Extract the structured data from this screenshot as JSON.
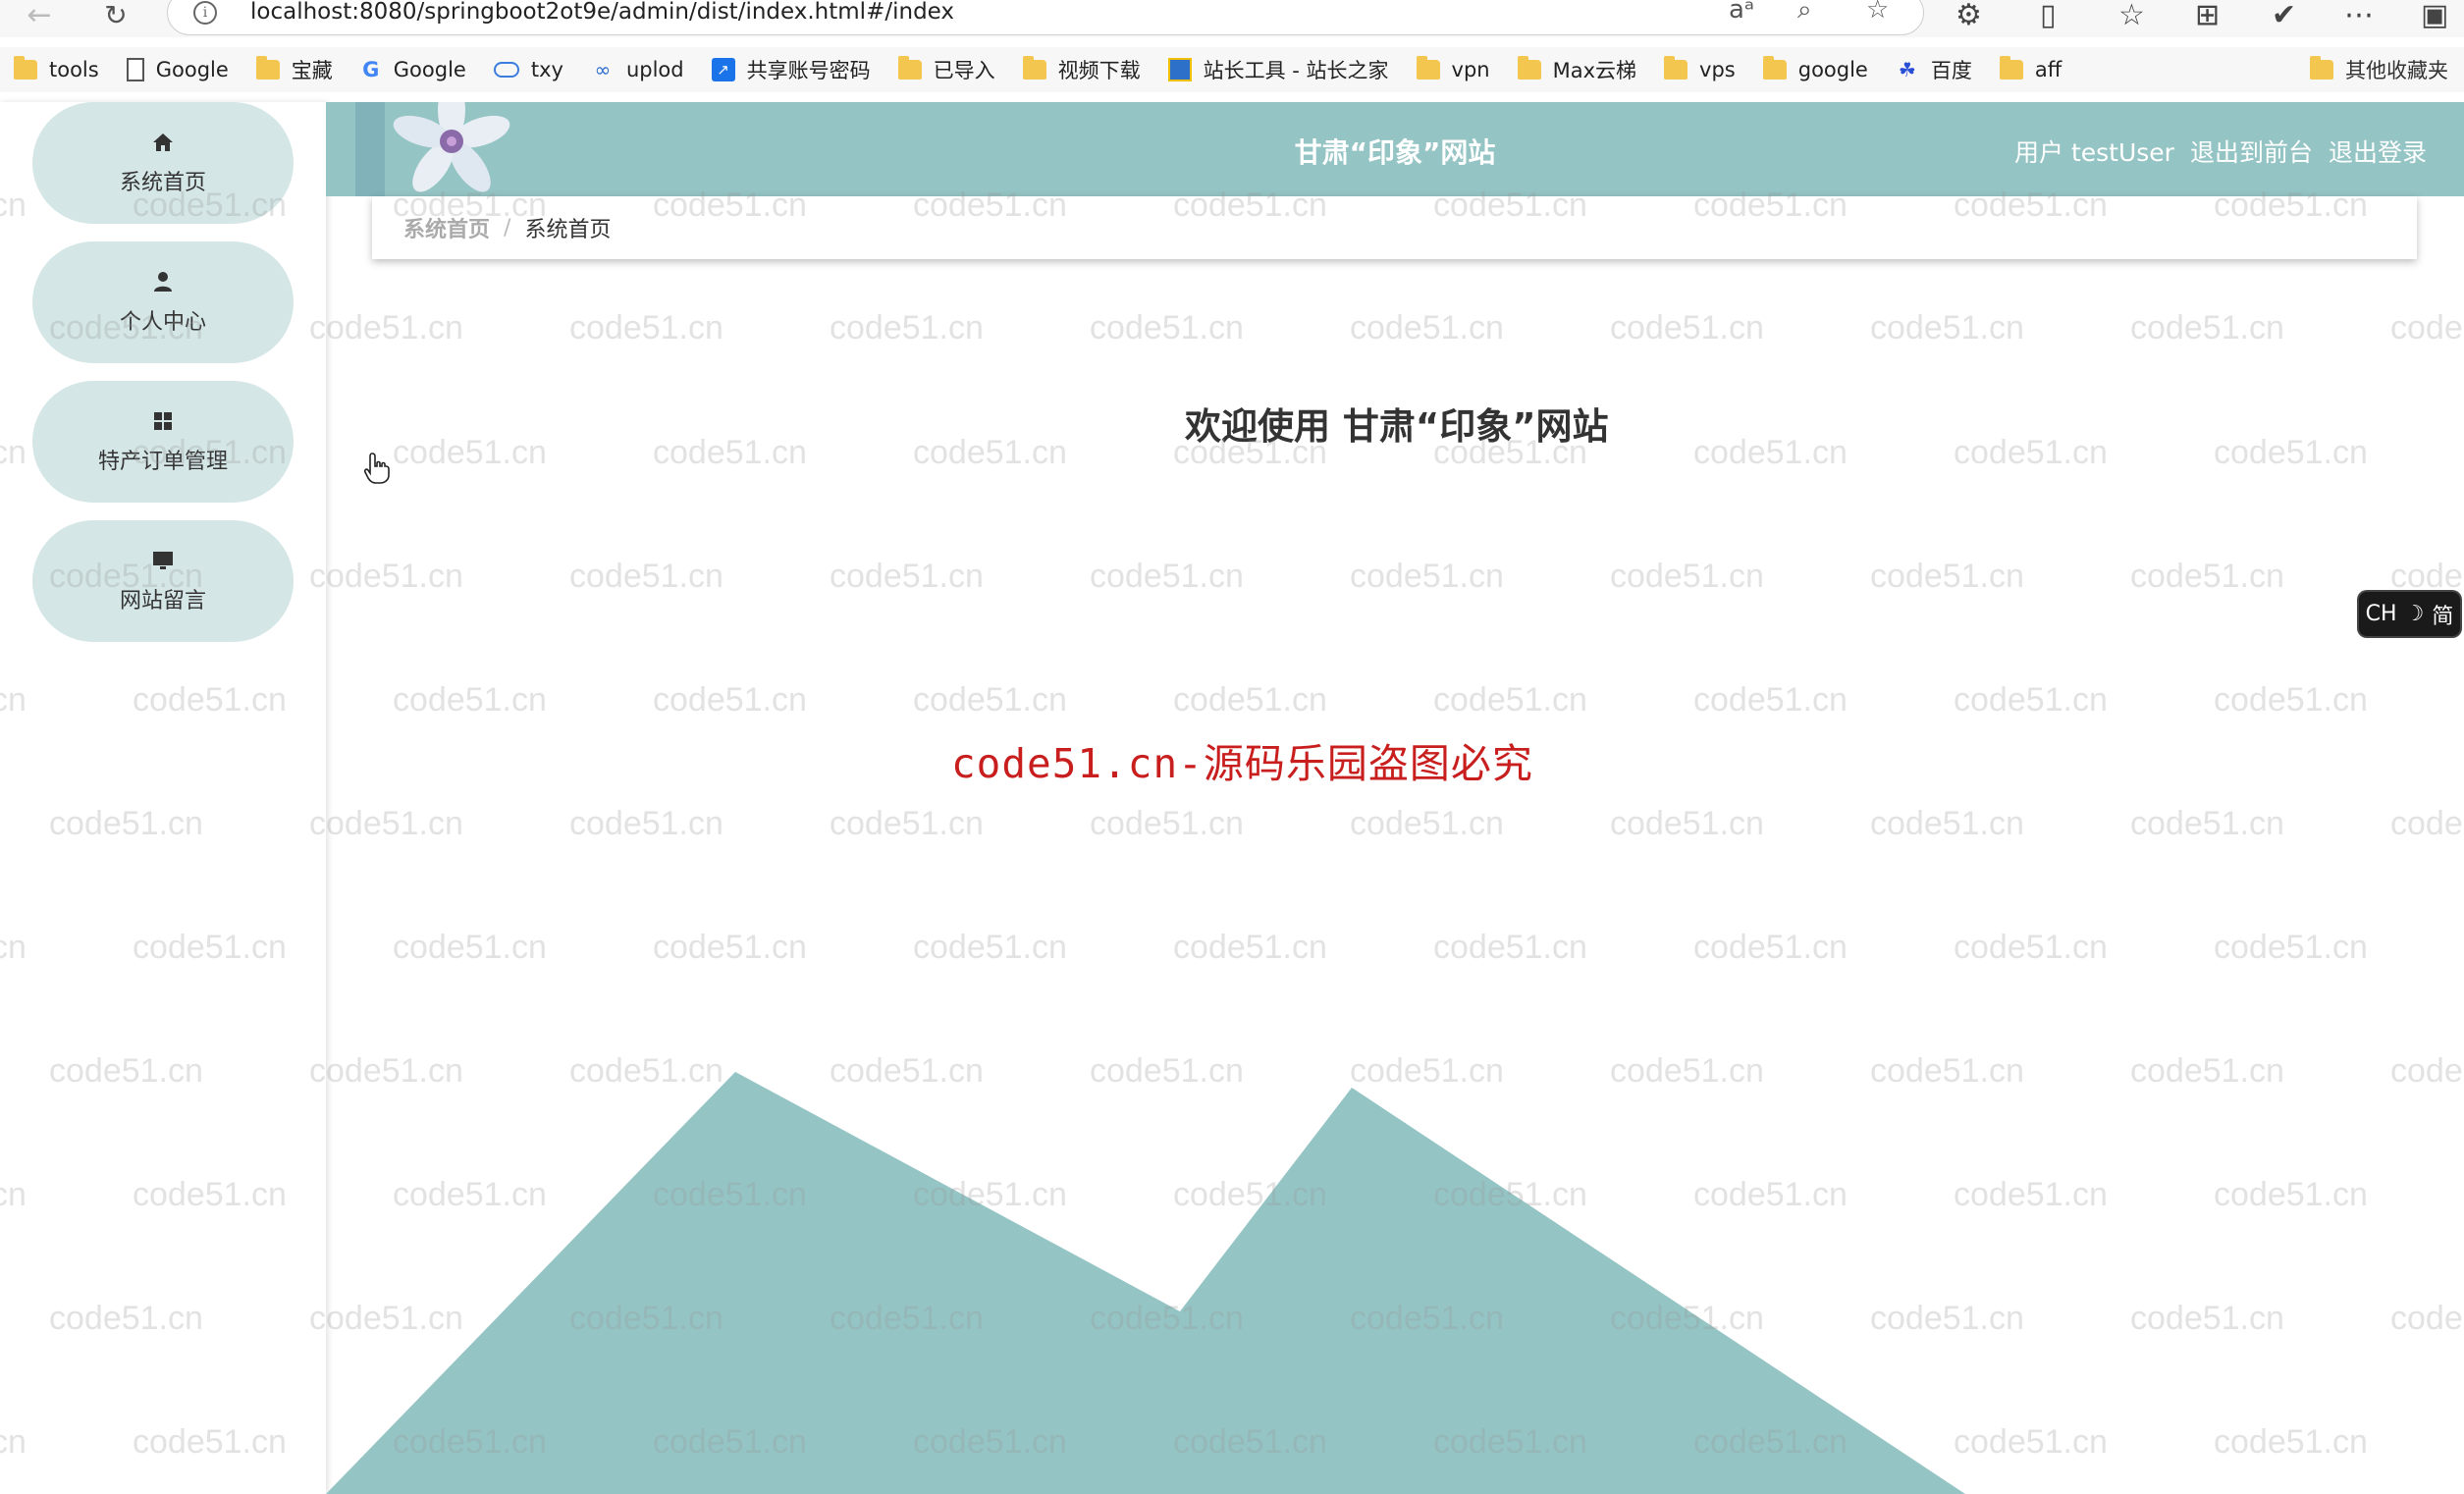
{
  "browser": {
    "url": "localhost:8080/springboot2ot9e/admin/dist/index.html#/index",
    "bookmarks": [
      {
        "label": "tools",
        "icon": "folder-icon"
      },
      {
        "label": "Google",
        "icon": "document-icon"
      },
      {
        "label": "宝藏",
        "icon": "folder-icon"
      },
      {
        "label": "Google",
        "icon": "google-icon"
      },
      {
        "label": "txy",
        "icon": "cloud-icon"
      },
      {
        "label": "uplod",
        "icon": "uplod-icon"
      },
      {
        "label": "共享账号密码",
        "icon": "share-icon"
      },
      {
        "label": "已导入",
        "icon": "folder-icon"
      },
      {
        "label": "视频下载",
        "icon": "folder-icon"
      },
      {
        "label": "站长工具 - 站长之家",
        "icon": "tool-icon"
      },
      {
        "label": "vpn",
        "icon": "folder-icon"
      },
      {
        "label": "Max云梯",
        "icon": "folder-icon"
      },
      {
        "label": "vps",
        "icon": "folder-icon"
      },
      {
        "label": "google",
        "icon": "folder-icon"
      },
      {
        "label": "百度",
        "icon": "baidu-icon"
      },
      {
        "label": "aff",
        "icon": "folder-icon"
      }
    ],
    "other_bookmarks": "其他收藏夹"
  },
  "sidebar": {
    "items": [
      {
        "label": "系统首页",
        "icon": "home-icon"
      },
      {
        "label": "个人中心",
        "icon": "user-icon"
      },
      {
        "label": "特产订单管理",
        "icon": "grid-icon"
      },
      {
        "label": "网站留言",
        "icon": "monitor-icon"
      }
    ]
  },
  "header": {
    "site_title": "甘肃“印象”网站",
    "user_label": "用户 testUser",
    "back_to_front": "退出到前台",
    "logout": "退出登录"
  },
  "breadcrumb": {
    "first": "系统首页",
    "separator": "/",
    "current": "系统首页"
  },
  "main": {
    "welcome": "欢迎使用 甘肃“印象”网站",
    "watermark_notice": "code51.cn-源码乐园盗图必究"
  },
  "watermark_text": "code51.cn",
  "ime": {
    "label": "CH",
    "mode": "简"
  },
  "colors": {
    "header_teal": "#95c4c4",
    "menu_item_bg": "#d5e6e6",
    "mountain_teal": "#95c4c4",
    "watermark_red": "#c81e1e"
  }
}
